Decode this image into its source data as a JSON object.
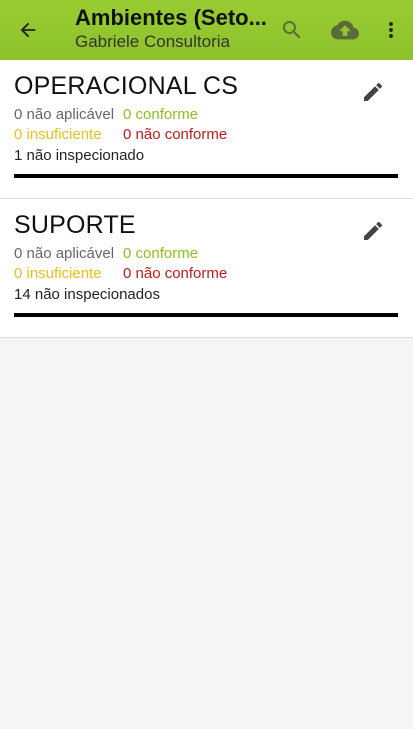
{
  "appbar": {
    "title": "Ambientes (Seto...",
    "subtitle": "Gabriele Consultoria",
    "back_icon": "arrow-back-icon",
    "search_icon": "search-icon",
    "upload_icon": "cloud-upload-icon",
    "menu_icon": "more-vert-icon"
  },
  "sectors": [
    {
      "name": "OPERACIONAL CS",
      "nao_aplicavel": "0 não aplicável",
      "conforme": "0 conforme",
      "insuficiente": "0 insuficiente",
      "nao_conforme": "0 não conforme",
      "nao_inspecionado": "1 não inspecionado"
    },
    {
      "name": "SUPORTE",
      "nao_aplicavel": "0 não aplicável",
      "conforme": "0 conforme",
      "insuficiente": "0 insuficiente",
      "nao_conforme": "0 não conforme",
      "nao_inspecionado": "14 não inspecionados"
    }
  ],
  "colors": {
    "appbar": "#99cc33",
    "conforme": "#8dbf1f",
    "insuficiente": "#e6c21a",
    "nao_conforme": "#c21a1a"
  }
}
